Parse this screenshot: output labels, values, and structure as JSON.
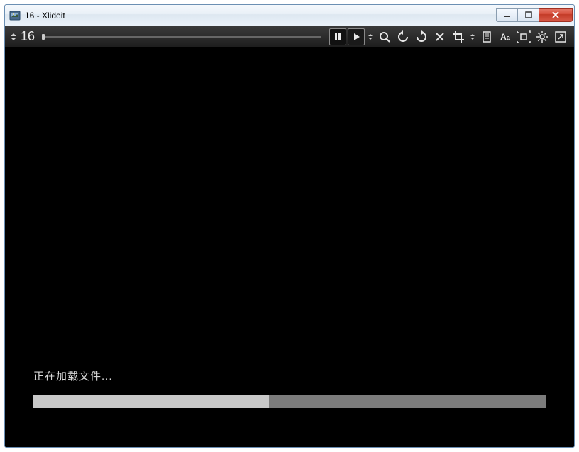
{
  "window": {
    "title": "16 - Xlideit"
  },
  "toolbar": {
    "file_number": "16"
  },
  "loading": {
    "label": "正在加载文件...",
    "progress_percent": 46
  },
  "icons": {
    "minimize": "minimize",
    "maximize": "maximize",
    "close": "close",
    "pause": "pause",
    "play": "play",
    "zoom": "search",
    "rotate_ccw": "rotate-ccw",
    "rotate_cw": "rotate-cw",
    "delete": "x",
    "crop": "crop",
    "sort": "sort",
    "document": "document",
    "text": "Aa",
    "fit": "fit-screen",
    "settings": "gear",
    "external": "open-external"
  }
}
